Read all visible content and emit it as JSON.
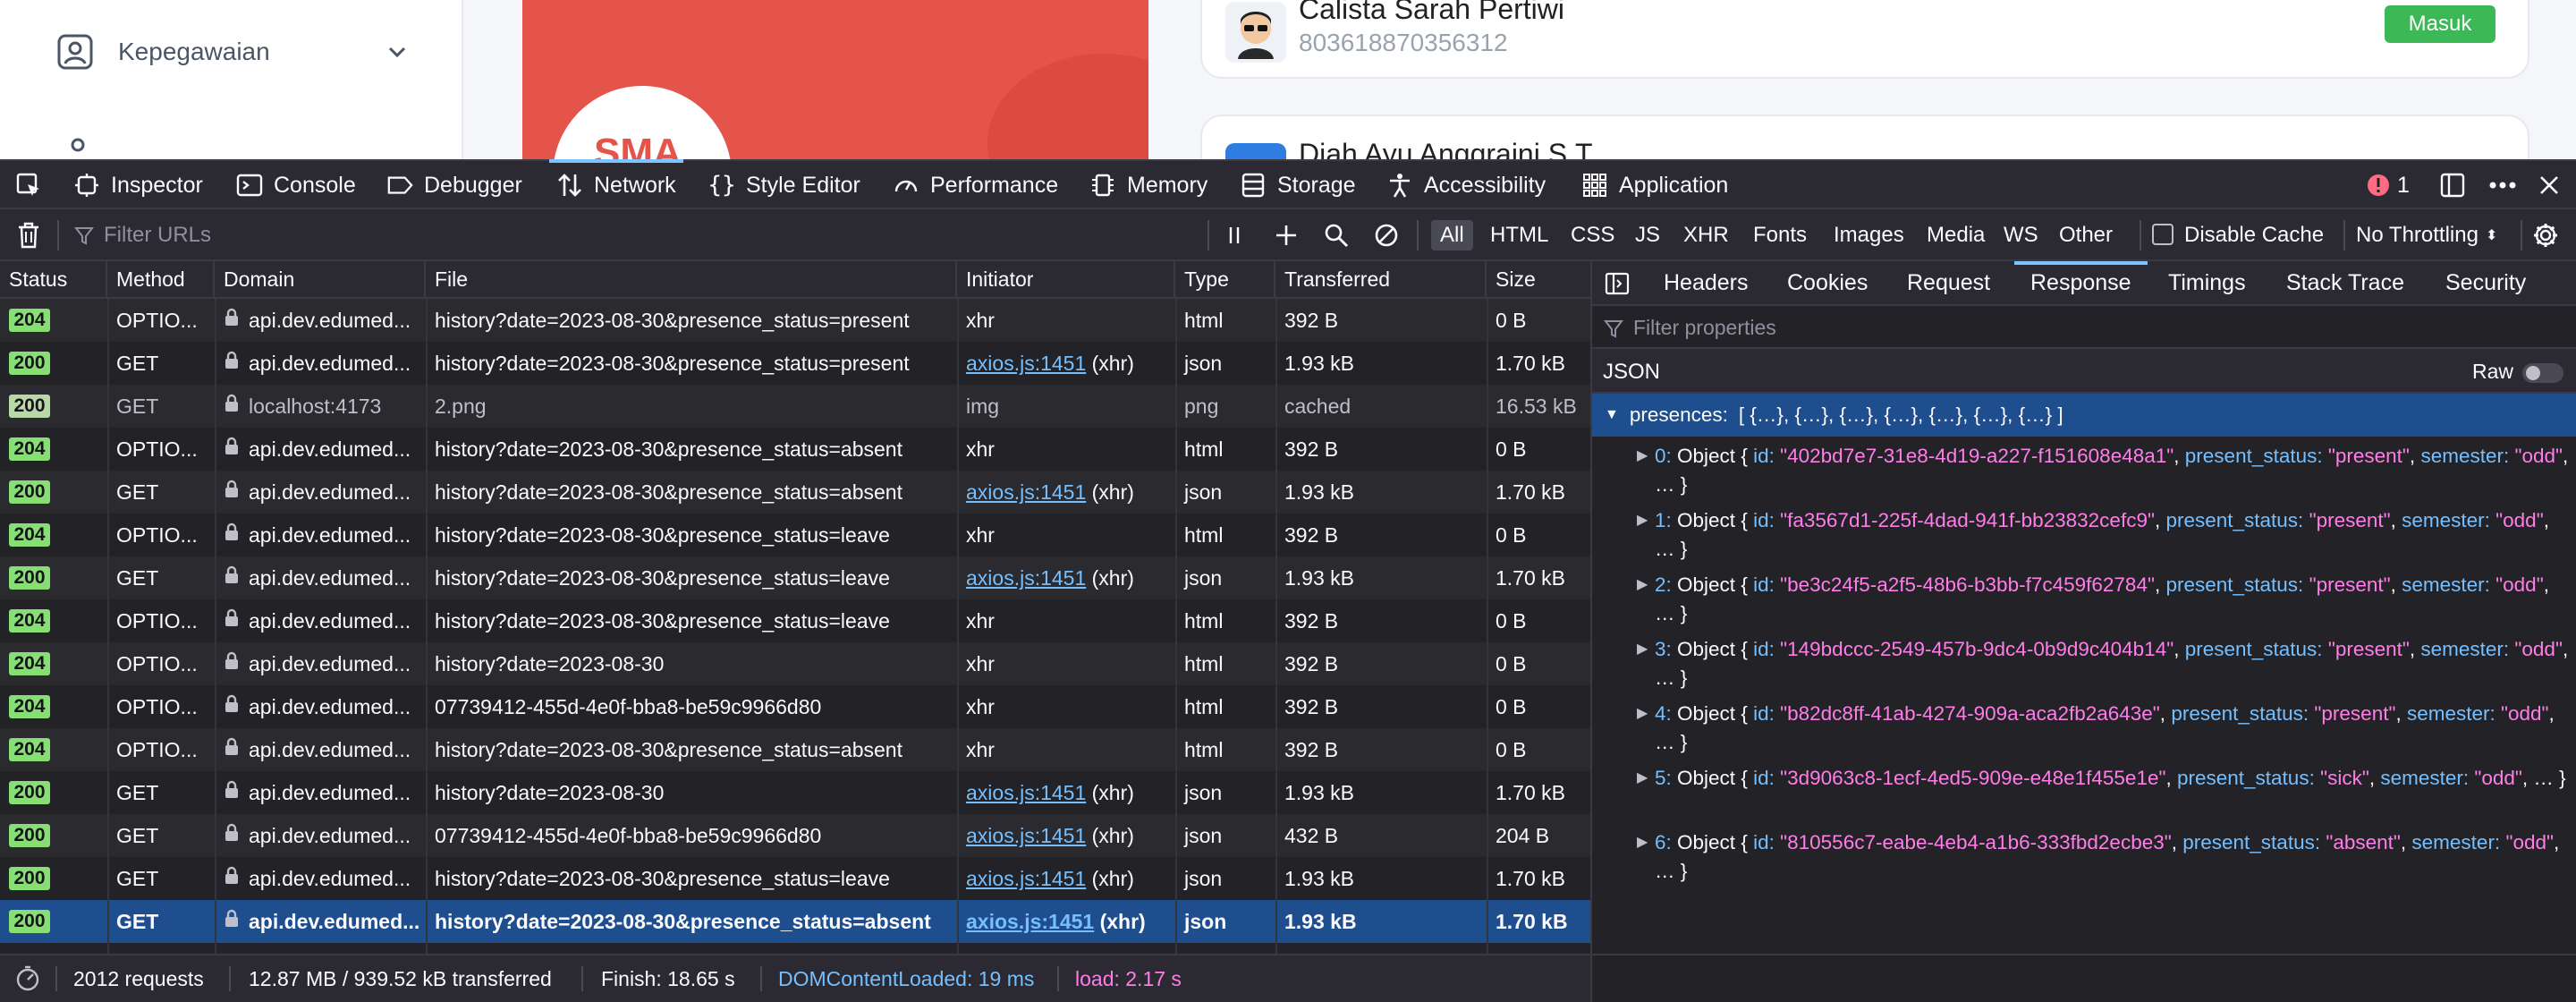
{
  "app": {
    "sidebar_item_label": "Kepegawaian",
    "banner_text": "SMA",
    "cards": [
      {
        "name": "Calista Sarah Pertiwi",
        "id_number": "803618870356312",
        "badge": "Masuk"
      },
      {
        "name": "Diah Ayu Anggraini S.T."
      }
    ],
    "colors": {
      "banner": "#e5544b",
      "badge": "#3cb857"
    }
  },
  "devtools": {
    "tabs": [
      {
        "label": "Inspector",
        "icon": "inspector-icon"
      },
      {
        "label": "Console",
        "icon": "console-icon"
      },
      {
        "label": "Debugger",
        "icon": "debugger-icon"
      },
      {
        "label": "Network",
        "icon": "network-icon"
      },
      {
        "label": "Style Editor",
        "icon": "style-editor-icon"
      },
      {
        "label": "Performance",
        "icon": "performance-icon"
      },
      {
        "label": "Memory",
        "icon": "memory-icon"
      },
      {
        "label": "Storage",
        "icon": "storage-icon"
      },
      {
        "label": "Accessibility",
        "icon": "accessibility-icon"
      },
      {
        "label": "Application",
        "icon": "application-icon"
      }
    ],
    "active_tab": "Network",
    "error_count": "1",
    "toolbar": {
      "filter_placeholder": "Filter URLs",
      "type_filters": [
        "All",
        "HTML",
        "CSS",
        "JS",
        "XHR",
        "Fonts",
        "Images",
        "Media",
        "WS",
        "Other"
      ],
      "active_type": "All",
      "disable_cache_label": "Disable Cache",
      "throttling_label": "No Throttling"
    },
    "columns": [
      "Status",
      "Method",
      "Domain",
      "File",
      "Initiator",
      "Type",
      "Transferred",
      "Size"
    ],
    "requests": [
      {
        "status": "204",
        "method": "OPTIO...",
        "domain": "api.dev.edumed...",
        "file": "history?date=2023-08-30&presence_status=present",
        "initiator": "xhr",
        "initiator_link": "",
        "type": "html",
        "transferred": "392 B",
        "size": "0 B"
      },
      {
        "status": "200",
        "method": "GET",
        "domain": "api.dev.edumed...",
        "file": "history?date=2023-08-30&presence_status=present",
        "initiator": " (xhr)",
        "initiator_link": "axios.js:1451",
        "type": "json",
        "transferred": "1.93 kB",
        "size": "1.70 kB"
      },
      {
        "status": "200",
        "method": "GET",
        "domain": "localhost:4173",
        "file": "2.png",
        "initiator": "img",
        "initiator_link": "",
        "type": "png",
        "transferred": "cached",
        "size": "16.53 kB",
        "dim": true
      },
      {
        "status": "204",
        "method": "OPTIO...",
        "domain": "api.dev.edumed...",
        "file": "history?date=2023-08-30&presence_status=absent",
        "initiator": "xhr",
        "initiator_link": "",
        "type": "html",
        "transferred": "392 B",
        "size": "0 B"
      },
      {
        "status": "200",
        "method": "GET",
        "domain": "api.dev.edumed...",
        "file": "history?date=2023-08-30&presence_status=absent",
        "initiator": " (xhr)",
        "initiator_link": "axios.js:1451",
        "type": "json",
        "transferred": "1.93 kB",
        "size": "1.70 kB"
      },
      {
        "status": "204",
        "method": "OPTIO...",
        "domain": "api.dev.edumed...",
        "file": "history?date=2023-08-30&presence_status=leave",
        "initiator": "xhr",
        "initiator_link": "",
        "type": "html",
        "transferred": "392 B",
        "size": "0 B"
      },
      {
        "status": "200",
        "method": "GET",
        "domain": "api.dev.edumed...",
        "file": "history?date=2023-08-30&presence_status=leave",
        "initiator": " (xhr)",
        "initiator_link": "axios.js:1451",
        "type": "json",
        "transferred": "1.93 kB",
        "size": "1.70 kB"
      },
      {
        "status": "204",
        "method": "OPTIO...",
        "domain": "api.dev.edumed...",
        "file": "history?date=2023-08-30&presence_status=leave",
        "initiator": "xhr",
        "initiator_link": "",
        "type": "html",
        "transferred": "392 B",
        "size": "0 B"
      },
      {
        "status": "204",
        "method": "OPTIO...",
        "domain": "api.dev.edumed...",
        "file": "history?date=2023-08-30",
        "initiator": "xhr",
        "initiator_link": "",
        "type": "html",
        "transferred": "392 B",
        "size": "0 B"
      },
      {
        "status": "204",
        "method": "OPTIO...",
        "domain": "api.dev.edumed...",
        "file": "07739412-455d-4e0f-bba8-be59c9966d80",
        "initiator": "xhr",
        "initiator_link": "",
        "type": "html",
        "transferred": "392 B",
        "size": "0 B"
      },
      {
        "status": "204",
        "method": "OPTIO...",
        "domain": "api.dev.edumed...",
        "file": "history?date=2023-08-30&presence_status=absent",
        "initiator": "xhr",
        "initiator_link": "",
        "type": "html",
        "transferred": "392 B",
        "size": "0 B"
      },
      {
        "status": "200",
        "method": "GET",
        "domain": "api.dev.edumed...",
        "file": "history?date=2023-08-30",
        "initiator": " (xhr)",
        "initiator_link": "axios.js:1451",
        "type": "json",
        "transferred": "1.93 kB",
        "size": "1.70 kB"
      },
      {
        "status": "200",
        "method": "GET",
        "domain": "api.dev.edumed...",
        "file": "07739412-455d-4e0f-bba8-be59c9966d80",
        "initiator": " (xhr)",
        "initiator_link": "axios.js:1451",
        "type": "json",
        "transferred": "432 B",
        "size": "204 B"
      },
      {
        "status": "200",
        "method": "GET",
        "domain": "api.dev.edumed...",
        "file": "history?date=2023-08-30&presence_status=leave",
        "initiator": " (xhr)",
        "initiator_link": "axios.js:1451",
        "type": "json",
        "transferred": "1.93 kB",
        "size": "1.70 kB"
      },
      {
        "status": "200",
        "method": "GET",
        "domain": "api.dev.edumed...",
        "file": "history?date=2023-08-30&presence_status=absent",
        "initiator": " (xhr)",
        "initiator_link": "axios.js:1451",
        "type": "json",
        "transferred": "1.93 kB",
        "size": "1.70 kB",
        "selected": true
      }
    ],
    "status_colors": {
      "204": "#86de74",
      "200": "#86de74",
      "dim200": "#b9d8a8"
    },
    "statusbar": {
      "requests": "2012 requests",
      "transferred": "12.87 MB / 939.52 kB transferred",
      "finish": "Finish: 18.65 s",
      "dom_content_loaded": "DOMContentLoaded: 19 ms",
      "load": "load: 2.17 s"
    },
    "side_panel": {
      "tabs": [
        "Headers",
        "Cookies",
        "Request",
        "Response",
        "Timings",
        "Stack Trace",
        "Security"
      ],
      "active_tab": "Response",
      "filter_placeholder": "Filter properties",
      "json_label": "JSON",
      "raw_label": "Raw",
      "root_key": "presences:",
      "root_value": "[ {…}, {…}, {…}, {…}, {…}, {…}, {…} ]",
      "items": [
        {
          "index": "0:",
          "id": "\"402bd7e7-31e8-4d19-a227-f151608e48a1\"",
          "present_status": "\"present\"",
          "semester": "\"odd\""
        },
        {
          "index": "1:",
          "id": "\"fa3567d1-225f-4dad-941f-bb23832cefc9\"",
          "present_status": "\"present\"",
          "semester": "\"odd\""
        },
        {
          "index": "2:",
          "id": "\"be3c24f5-a2f5-48b6-b3bb-f7c459f62784\"",
          "present_status": "\"present\"",
          "semester": "\"odd\""
        },
        {
          "index": "3:",
          "id": "\"149bdccc-2549-457b-9dc4-0b9d9c404b14\"",
          "present_status": "\"present\"",
          "semester": "\"odd\""
        },
        {
          "index": "4:",
          "id": "\"b82dc8ff-41ab-4274-909a-aca2fb2a643e\"",
          "present_status": "\"present\"",
          "semester": "\"odd\""
        },
        {
          "index": "5:",
          "id": "\"3d9063c8-1ecf-4ed5-909e-e48e1f455e1e\"",
          "present_status": "\"sick\"",
          "semester": "\"odd\""
        },
        {
          "index": "6:",
          "id": "\"810556c7-eabe-4eb4-a1b6-333fbd2ecbe3\"",
          "present_status": "\"absent\"",
          "semester": "\"odd\""
        }
      ],
      "object_word": "Object",
      "id_key": "id:",
      "status_key": "present_status:",
      "semester_key": "semester:"
    }
  }
}
